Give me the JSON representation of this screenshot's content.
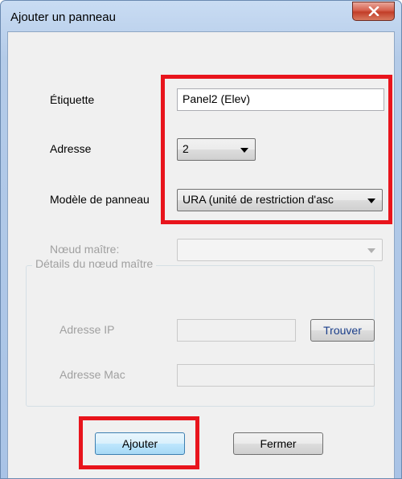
{
  "window": {
    "title": "Ajouter un panneau",
    "close_icon": "close-icon"
  },
  "form": {
    "label_label": "Étiquette",
    "label_value": "Panel2 (Elev)",
    "address_label": "Adresse",
    "address_value": "2",
    "model_label": "Modèle de panneau",
    "model_value": "URA (unité de restriction d'asc",
    "master_node_label": "Nœud maître:",
    "master_node_value": ""
  },
  "master_details": {
    "title": "Détails du nœud maître",
    "ip_label": "Adresse IP",
    "ip_value": "",
    "find_button": "Trouver",
    "mac_label": "Adresse Mac",
    "mac_value": ""
  },
  "buttons": {
    "add": "Ajouter",
    "close": "Fermer"
  },
  "colors": {
    "highlight": "#e8141c",
    "disabled_text": "#a0a0a0"
  }
}
